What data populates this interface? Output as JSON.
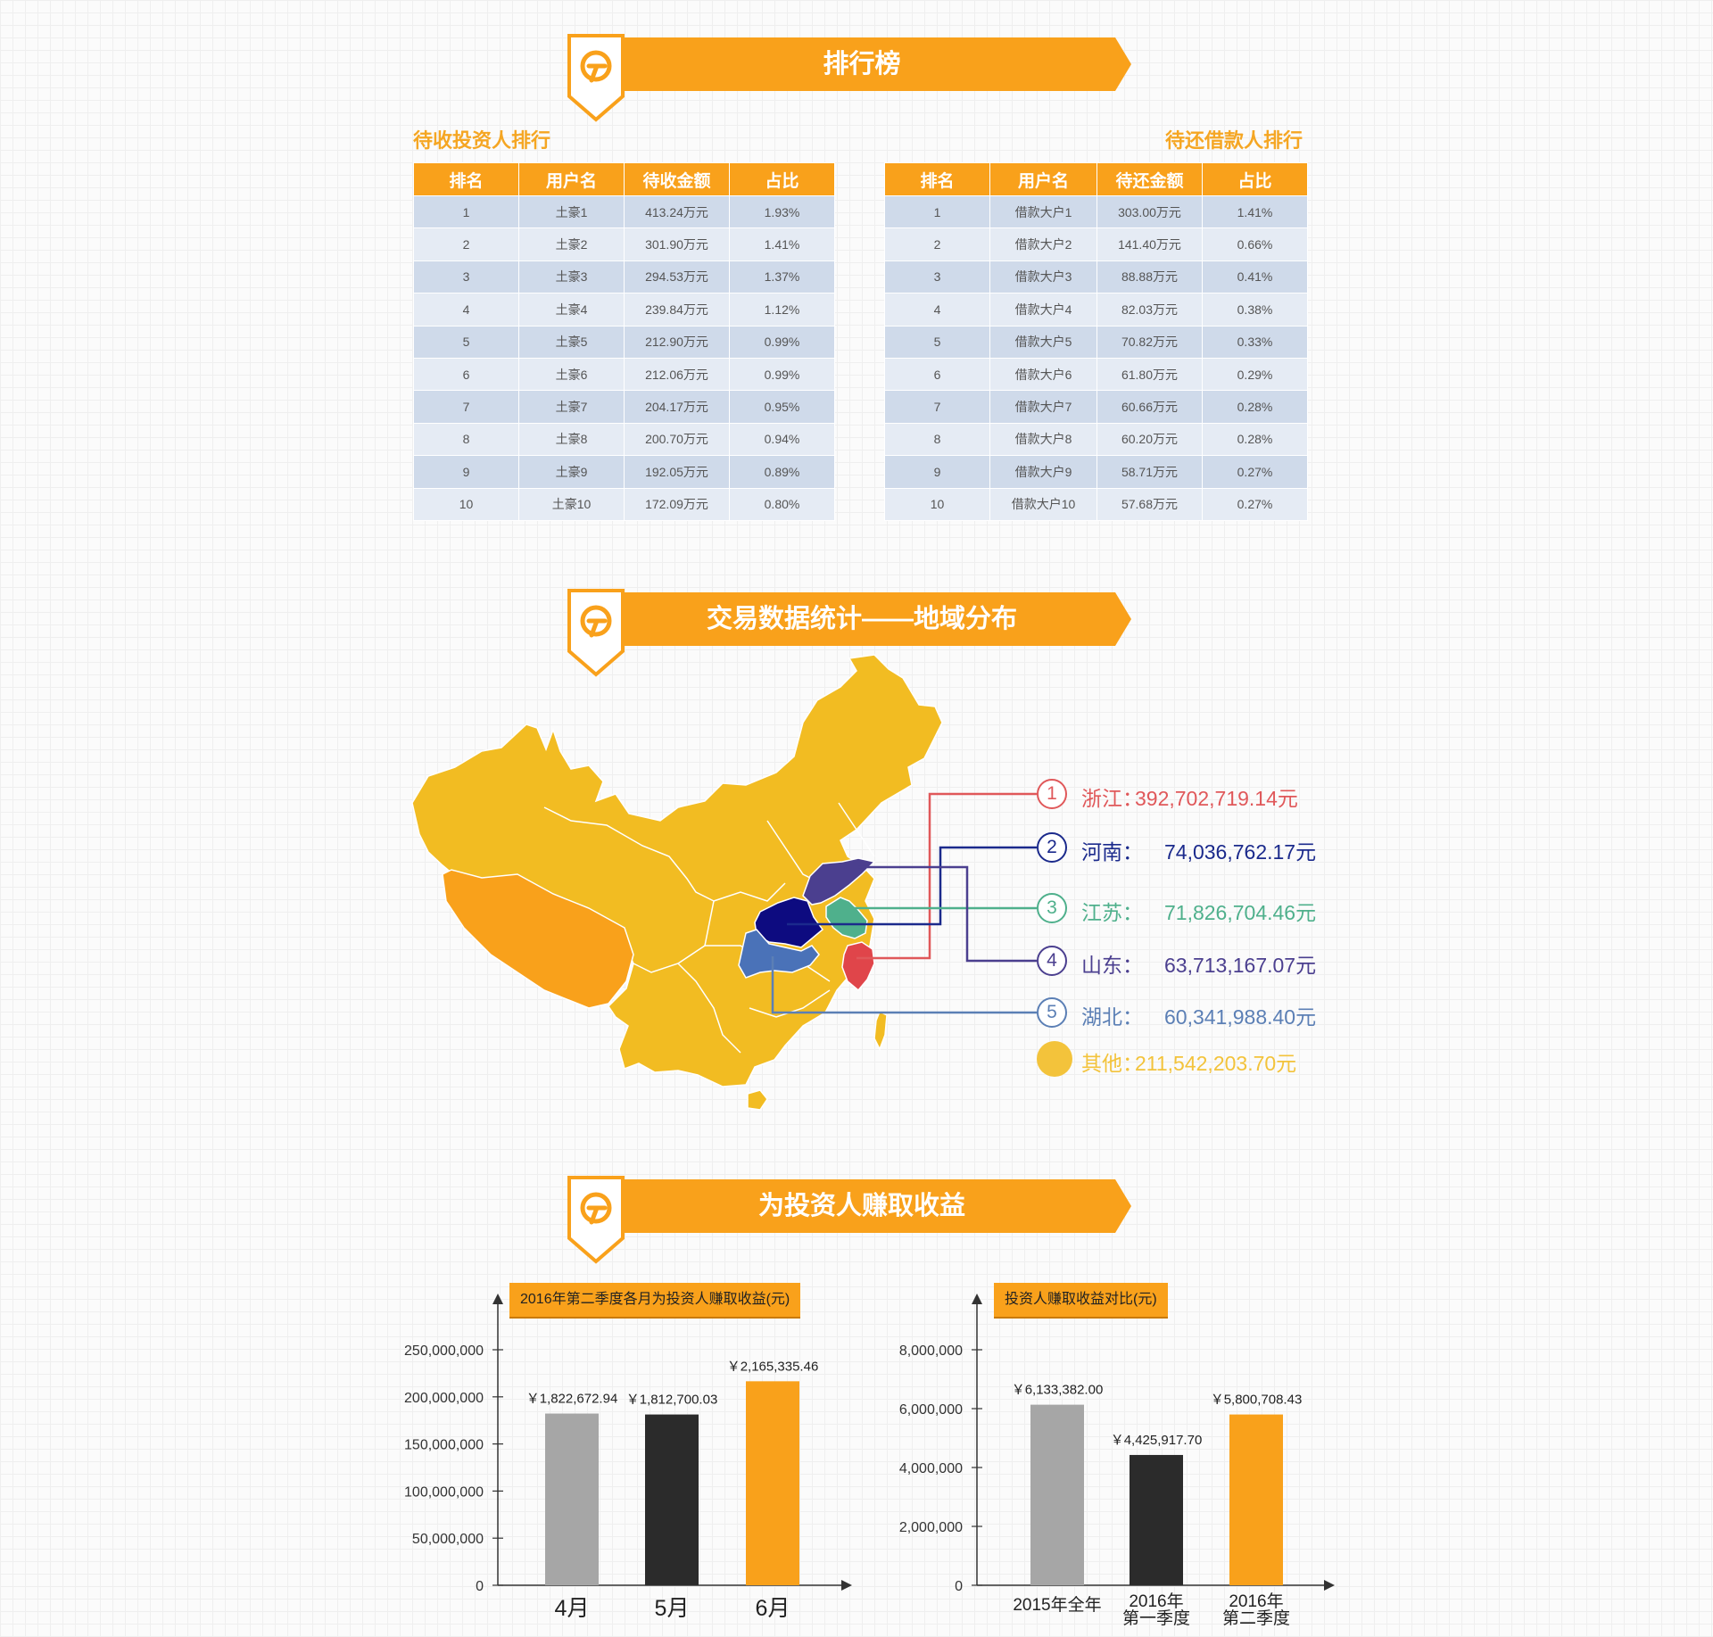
{
  "sections": {
    "ranking_title": "排行榜",
    "region_title": "交易数据统计——地域分布",
    "earnings_title": "为投资人赚取收益"
  },
  "investor_table": {
    "title": "待收投资人排行",
    "headers": [
      "排名",
      "用户名",
      "待收金额",
      "占比"
    ],
    "rows": [
      [
        "1",
        "土豪1",
        "413.24万元",
        "1.93%"
      ],
      [
        "2",
        "土豪2",
        "301.90万元",
        "1.41%"
      ],
      [
        "3",
        "土豪3",
        "294.53万元",
        "1.37%"
      ],
      [
        "4",
        "土豪4",
        "239.84万元",
        "1.12%"
      ],
      [
        "5",
        "土豪5",
        "212.90万元",
        "0.99%"
      ],
      [
        "6",
        "土豪6",
        "212.06万元",
        "0.99%"
      ],
      [
        "7",
        "土豪7",
        "204.17万元",
        "0.95%"
      ],
      [
        "8",
        "土豪8",
        "200.70万元",
        "0.94%"
      ],
      [
        "9",
        "土豪9",
        "192.05万元",
        "0.89%"
      ],
      [
        "10",
        "土豪10",
        "172.09万元",
        "0.80%"
      ]
    ]
  },
  "borrower_table": {
    "title": "待还借款人排行",
    "headers": [
      "排名",
      "用户名",
      "待还金额",
      "占比"
    ],
    "rows": [
      [
        "1",
        "借款大户1",
        "303.00万元",
        "1.41%"
      ],
      [
        "2",
        "借款大户2",
        "141.40万元",
        "0.66%"
      ],
      [
        "3",
        "借款大户3",
        "88.88万元",
        "0.41%"
      ],
      [
        "4",
        "借款大户4",
        "82.03万元",
        "0.38%"
      ],
      [
        "5",
        "借款大户5",
        "70.82万元",
        "0.33%"
      ],
      [
        "6",
        "借款大户6",
        "61.80万元",
        "0.29%"
      ],
      [
        "7",
        "借款大户7",
        "60.66万元",
        "0.28%"
      ],
      [
        "8",
        "借款大户8",
        "60.20万元",
        "0.28%"
      ],
      [
        "9",
        "借款大户9",
        "58.71万元",
        "0.27%"
      ],
      [
        "10",
        "借款大户10",
        "57.68万元",
        "0.27%"
      ]
    ]
  },
  "region_legend": [
    {
      "num": "1",
      "label": "浙江：",
      "value": "392,702,719.14元",
      "color": "#e0585a"
    },
    {
      "num": "2",
      "label": "河南：",
      "value": "74,036,762.17元",
      "color": "#1b2a8c"
    },
    {
      "num": "3",
      "label": "江苏：",
      "value": "71,826,704.46元",
      "color": "#4fb08c"
    },
    {
      "num": "4",
      "label": "山东：",
      "value": "63,713,167.07元",
      "color": "#4b3f8f"
    },
    {
      "num": "5",
      "label": "湖北：",
      "value": "60,341,988.40元",
      "color": "#5b7fb5"
    },
    {
      "num": "",
      "label": "其他：",
      "value": "211,542,203.70元",
      "color": "#f3c33b"
    }
  ],
  "map_colors": {
    "base": "#f2bc22",
    "tibet": "#f9a11b",
    "henan": "#0d0b80",
    "shandong": "#4b3f8f",
    "jiangsu": "#4fb08c",
    "hubei": "#4a72b8",
    "zhejiang": "#e0454a"
  },
  "chart_data": [
    {
      "type": "bar",
      "title": "2016年第二季度各月为投资人赚取收益(元)",
      "categories": [
        "4月",
        "5月",
        "6月"
      ],
      "values": [
        182267294,
        181270003,
        216533546
      ],
      "data_labels": [
        "￥1,822,672.94",
        "￥1,812,700.03",
        "￥2,165,335.46"
      ],
      "colors": [
        "#a6a6a6",
        "#2b2b2b",
        "#f9a11b"
      ],
      "yticks": [
        "0",
        "50,000,000",
        "100,000,000",
        "150,000,000",
        "200,000,000",
        "250,000,000"
      ],
      "ylim": [
        0,
        250000000
      ]
    },
    {
      "type": "bar",
      "title": "投资人赚取收益对比(元)",
      "categories": [
        [
          "2015年全年"
        ],
        [
          "2016年",
          "第一季度"
        ],
        [
          "2016年",
          "第二季度"
        ]
      ],
      "values": [
        6133382.0,
        4425917.7,
        5800708.43
      ],
      "data_labels": [
        "￥6,133,382.00",
        "￥4,425,917.70",
        "￥5,800,708.43"
      ],
      "colors": [
        "#a6a6a6",
        "#2b2b2b",
        "#f9a11b"
      ],
      "yticks": [
        "0",
        "2,000,000",
        "4,000,000",
        "6,000,000",
        "8,000,000"
      ],
      "ylim": [
        0,
        8000000
      ]
    }
  ]
}
